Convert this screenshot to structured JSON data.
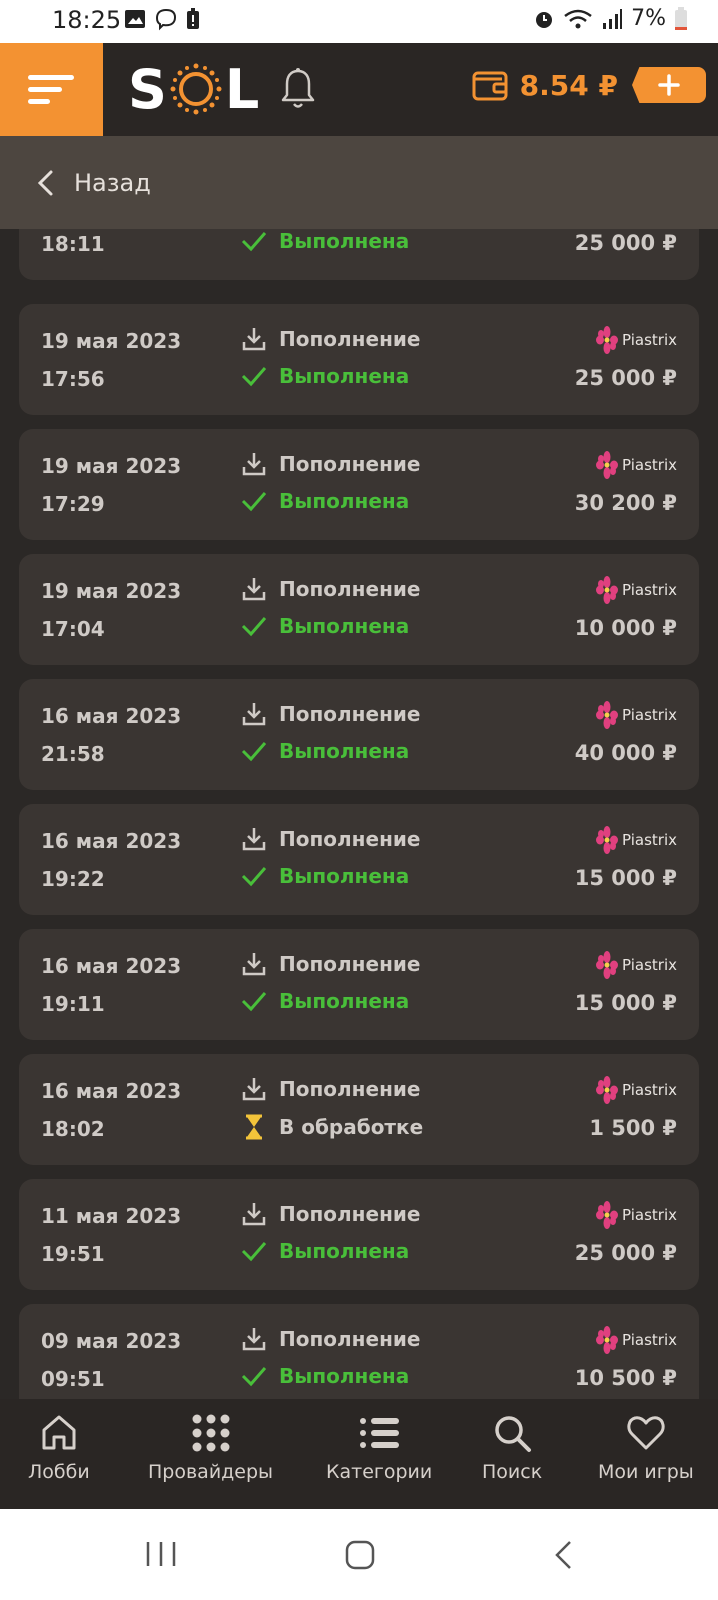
{
  "status_bar": {
    "time": "18:25",
    "battery": "7%"
  },
  "header": {
    "logo_left": "S",
    "logo_right": "L",
    "balance": "8.54 ₽"
  },
  "back_label": "Назад",
  "colors": {
    "accent": "#f39232",
    "success": "#49bf3a",
    "card": "#3a3532"
  },
  "transactions": [
    {
      "date": "",
      "time": "18:11",
      "type": "",
      "status": "Выполнена",
      "provider": "",
      "amount": "25 000 ₽",
      "state": "ok"
    },
    {
      "date": "19 мая 2023",
      "time": "17:56",
      "type": "Пополнение",
      "status": "Выполнена",
      "provider": "Piastrix",
      "amount": "25 000 ₽",
      "state": "ok"
    },
    {
      "date": "19 мая 2023",
      "time": "17:29",
      "type": "Пополнение",
      "status": "Выполнена",
      "provider": "Piastrix",
      "amount": "30 200 ₽",
      "state": "ok"
    },
    {
      "date": "19 мая 2023",
      "time": "17:04",
      "type": "Пополнение",
      "status": "Выполнена",
      "provider": "Piastrix",
      "amount": "10 000 ₽",
      "state": "ok"
    },
    {
      "date": "16 мая 2023",
      "time": "21:58",
      "type": "Пополнение",
      "status": "Выполнена",
      "provider": "Piastrix",
      "amount": "40 000 ₽",
      "state": "ok"
    },
    {
      "date": "16 мая 2023",
      "time": "19:22",
      "type": "Пополнение",
      "status": "Выполнена",
      "provider": "Piastrix",
      "amount": "15 000 ₽",
      "state": "ok"
    },
    {
      "date": "16 мая 2023",
      "time": "19:11",
      "type": "Пополнение",
      "status": "Выполнена",
      "provider": "Piastrix",
      "amount": "15 000 ₽",
      "state": "ok"
    },
    {
      "date": "16 мая 2023",
      "time": "18:02",
      "type": "Пополнение",
      "status": "В обработке",
      "provider": "Piastrix",
      "amount": "1 500 ₽",
      "state": "wait"
    },
    {
      "date": "11 мая 2023",
      "time": "19:51",
      "type": "Пополнение",
      "status": "Выполнена",
      "provider": "Piastrix",
      "amount": "25 000 ₽",
      "state": "ok"
    },
    {
      "date": "09 мая 2023",
      "time": "09:51",
      "type": "Пополнение",
      "status": "Выполнена",
      "provider": "Piastrix",
      "amount": "10 500 ₽",
      "state": "ok"
    }
  ],
  "bottom_nav": [
    {
      "label": "Лобби",
      "icon": "home-icon"
    },
    {
      "label": "Провайдеры",
      "icon": "grid-icon"
    },
    {
      "label": "Категории",
      "icon": "list-icon"
    },
    {
      "label": "Поиск",
      "icon": "search-icon"
    },
    {
      "label": "Мои игры",
      "icon": "heart-icon"
    }
  ]
}
